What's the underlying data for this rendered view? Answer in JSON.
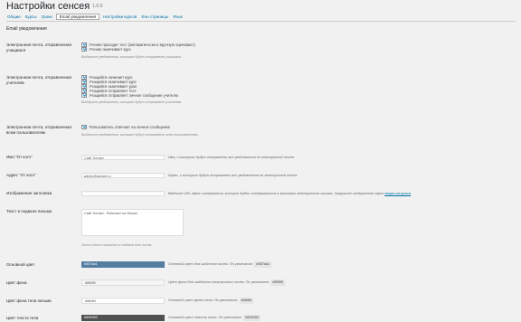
{
  "header": {
    "title": "Настройки сенсея",
    "version": "1.0.0"
  },
  "tabs": [
    {
      "label": "Общие",
      "active": false
    },
    {
      "label": "Курсы",
      "active": false
    },
    {
      "label": "Уроки",
      "active": false
    },
    {
      "label": "Email уведомления",
      "active": true
    },
    {
      "label": "Настройки курсов",
      "active": false
    },
    {
      "label": "Фон страницы",
      "active": false
    },
    {
      "label": "Язык",
      "active": false
    }
  ],
  "section_title": "Email уведомления",
  "fields": {
    "learners": {
      "label": "Электронная почта, отправленная учащимся",
      "options": [
        {
          "label": "Ученик проходит тест (автоматически и вручную оценивает)",
          "checked": true
        },
        {
          "label": "Ученик оканчивает курс",
          "checked": true
        }
      ],
      "description": "Выберите уведомления, которые будут отправлены учащимся."
    },
    "teachers": {
      "label": "Электронная почта, отправленная учителям",
      "options": [
        {
          "label": "Учащийся начинает курс",
          "checked": true
        },
        {
          "label": "Учащийся оканчивает курс",
          "checked": true
        },
        {
          "label": "Учащийся оканчивает урок",
          "checked": true
        },
        {
          "label": "Учащийся отправляет тест",
          "checked": true
        },
        {
          "label": "Учащийся отправляет личное сообщение учителю",
          "checked": true
        }
      ],
      "description": "Выберите уведомления, которые будут отправлены учителям."
    },
    "global": {
      "label": "Электронная почта, отправленная всем пользователям",
      "options": [
        {
          "label": "Пользователь отвечает на личное сообщение",
          "checked": true
        }
      ],
      "description": "Выберите уведомления, которые будут отправлены всем пользователям."
    },
    "from_name": {
      "label": "Имя \"От кого\"",
      "value": "Сайт Sensei",
      "description": "Имя, с которого будут отправлены все уведомления по электронной почте."
    },
    "from_address": {
      "label": "Адрес \"От кого\"",
      "value": "admin@sensei.ru",
      "description": "Адрес, с которого будут отправлены все уведомления по электронной почте."
    },
    "header_image": {
      "label": "Изображение заголовка",
      "value": "",
      "description": "Введите URL-адрес изображения, которое будет отображаться в заголовке электронного письма. Загрузите изображения через ",
      "link": "медиа-загрузчик"
    },
    "footer_text": {
      "label": "Текст в подвале письма",
      "value": "Сайт Sensei - Работает на Sensei",
      "description": "Этот текст появится в подвале всех писем."
    },
    "base_color": {
      "label": "Основной цвет",
      "value": "#557da1",
      "description": "Основной цвет для шаблонов писем. По умолчанию ",
      "default": "#557da1"
    },
    "bg_color": {
      "label": "Цвет фона",
      "value": "#f5f5f5",
      "description": "Цвет фона для шаблонов электронных писем. По умолчанию ",
      "default": "#f5f5f5"
    },
    "body_bg_color": {
      "label": "Цвет фона тела письма",
      "value": "#fdfdfd",
      "description": "Основной цвет фона тела. По умолчанию ",
      "default": "#fdfdfd"
    },
    "body_text_color": {
      "label": "Цвет текста тела",
      "value": "#505050",
      "description": "Основной цвет текста тела. По умолчанию ",
      "default": "#505050"
    }
  },
  "colors": {
    "accent": "#0073aa",
    "base": "#557da1",
    "text_dark": "#505050"
  }
}
